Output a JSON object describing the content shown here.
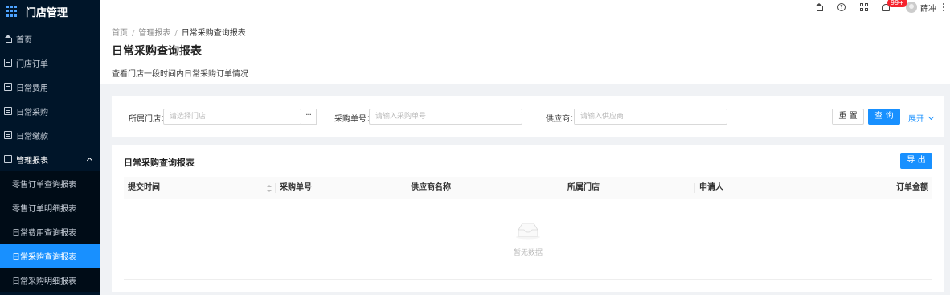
{
  "app": {
    "title": "门店管理"
  },
  "sidebar": {
    "items": [
      {
        "label": "首页",
        "icon": "home-icon"
      },
      {
        "label": "门店订单",
        "icon": "document-icon"
      },
      {
        "label": "日常费用",
        "icon": "document-icon"
      },
      {
        "label": "日常采购",
        "icon": "document-icon"
      },
      {
        "label": "日常缴款",
        "icon": "document-icon"
      }
    ],
    "group": {
      "label": "管理报表",
      "icon": "calendar-icon",
      "children": [
        {
          "label": "零售订单查询报表",
          "active": false
        },
        {
          "label": "零售订单明细报表",
          "active": false
        },
        {
          "label": "日常费用查询报表",
          "active": false
        },
        {
          "label": "日常采购查询报表",
          "active": true
        },
        {
          "label": "日常采购明细报表",
          "active": false
        }
      ]
    }
  },
  "header": {
    "notification_badge": "99+",
    "username": "薛冲"
  },
  "breadcrumb": {
    "items": [
      "首页",
      "管理报表",
      "日常采购查询报表"
    ],
    "separator": "/"
  },
  "page": {
    "title": "日常采购查询报表",
    "description": "查看门店一段时间内日常采购订单情况"
  },
  "filters": {
    "store_label": "所属门店：",
    "store_placeholder": "请选择门店",
    "store_picker": "···",
    "po_label": "采购单号：",
    "po_placeholder": "请输入采购单号",
    "supplier_label": "供应商：",
    "supplier_placeholder": "请输入供应商",
    "reset_label": "重 置",
    "query_label": "查 询",
    "expand_label": "展开"
  },
  "table": {
    "title": "日常采购查询报表",
    "export_label": "导 出",
    "columns": [
      "提交时间",
      "采购单号",
      "供应商名称",
      "所属门店",
      "申请人",
      "订单金额"
    ],
    "empty_text": "暂无数据",
    "rows": []
  },
  "colors": {
    "primary": "#1890ff",
    "sidebar_bg": "#001529",
    "badge": "#f5222d"
  }
}
